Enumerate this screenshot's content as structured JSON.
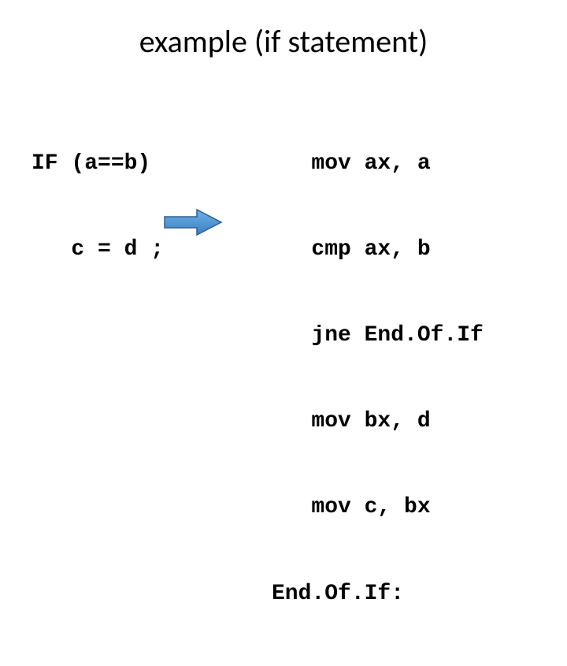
{
  "title": "example (if statement)",
  "source": {
    "line1": "IF (a==b)",
    "line2": "   c = d ;"
  },
  "asm": {
    "line1": "   mov ax, a",
    "line2": "   cmp ax, b",
    "line3": "   jne End.Of.If",
    "line4": "   mov bx, d",
    "line5": "   mov c, bx",
    "line6": "End.Of.If:"
  }
}
